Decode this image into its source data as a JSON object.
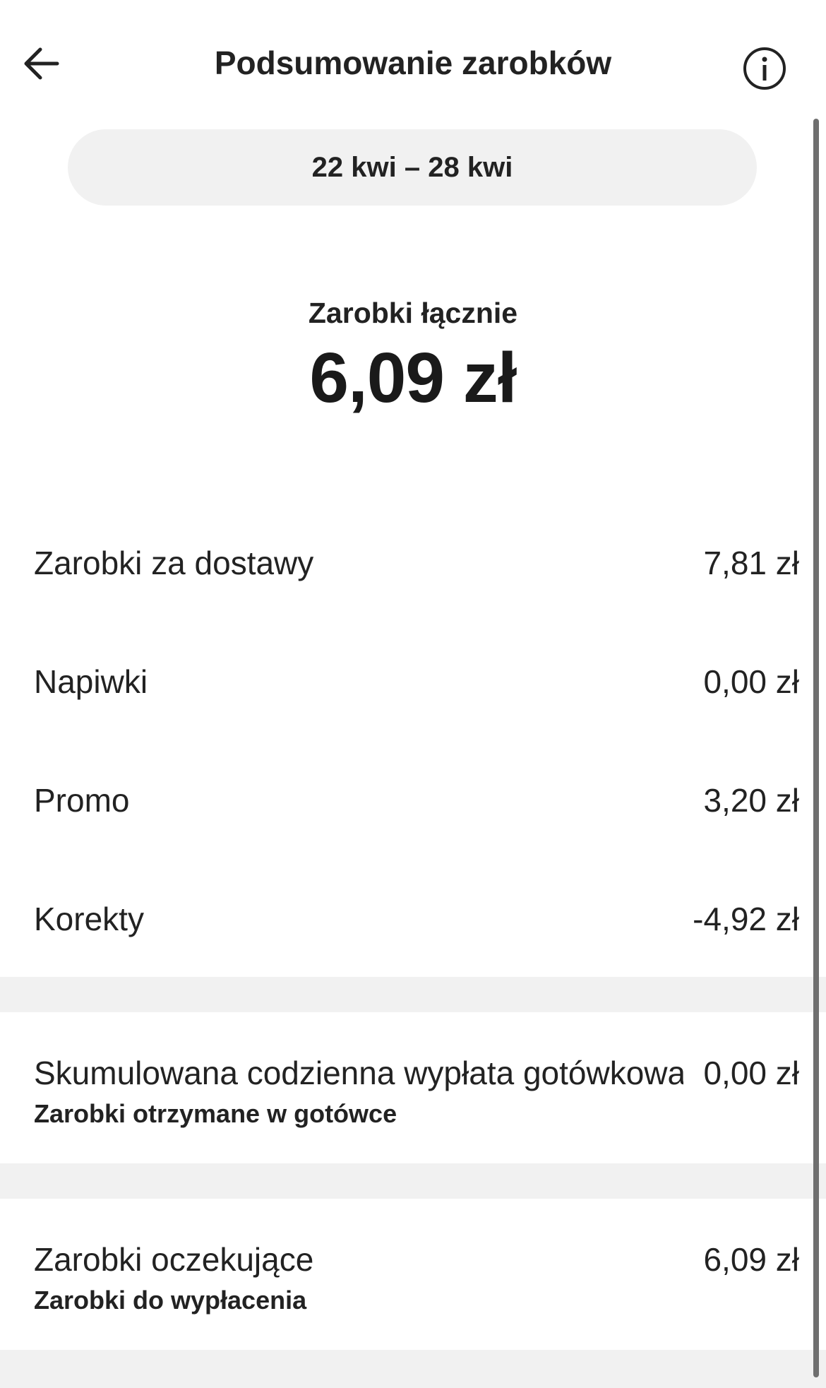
{
  "header": {
    "title": "Podsumowanie zarobków",
    "back_icon": "arrow-left-icon",
    "info_icon": "info-icon"
  },
  "date_range": "22 kwi – 28 kwi",
  "total": {
    "label": "Zarobki łącznie",
    "value": "6,09 zł"
  },
  "breakdown": [
    {
      "label": "Zarobki za dostawy",
      "value": "7,81 zł"
    },
    {
      "label": "Napiwki",
      "value": "0,00 zł"
    },
    {
      "label": "Promo",
      "value": "3,20 zł"
    },
    {
      "label": "Korekty",
      "value": "-4,92 zł"
    }
  ],
  "cash": {
    "label": "Skumulowana codzienna wypłata gotówkowa",
    "value": "0,00 zł",
    "sublabel": "Zarobki otrzymane w gotówce"
  },
  "pending": {
    "label": "Zarobki oczekujące",
    "value": "6,09 zł",
    "sublabel": "Zarobki do wypłacenia"
  },
  "colors": {
    "background": "#ffffff",
    "pill": "#f1f1f1",
    "separator": "#f1f1f1",
    "text": "#222222",
    "scrollbar": "#6f6f6f"
  }
}
